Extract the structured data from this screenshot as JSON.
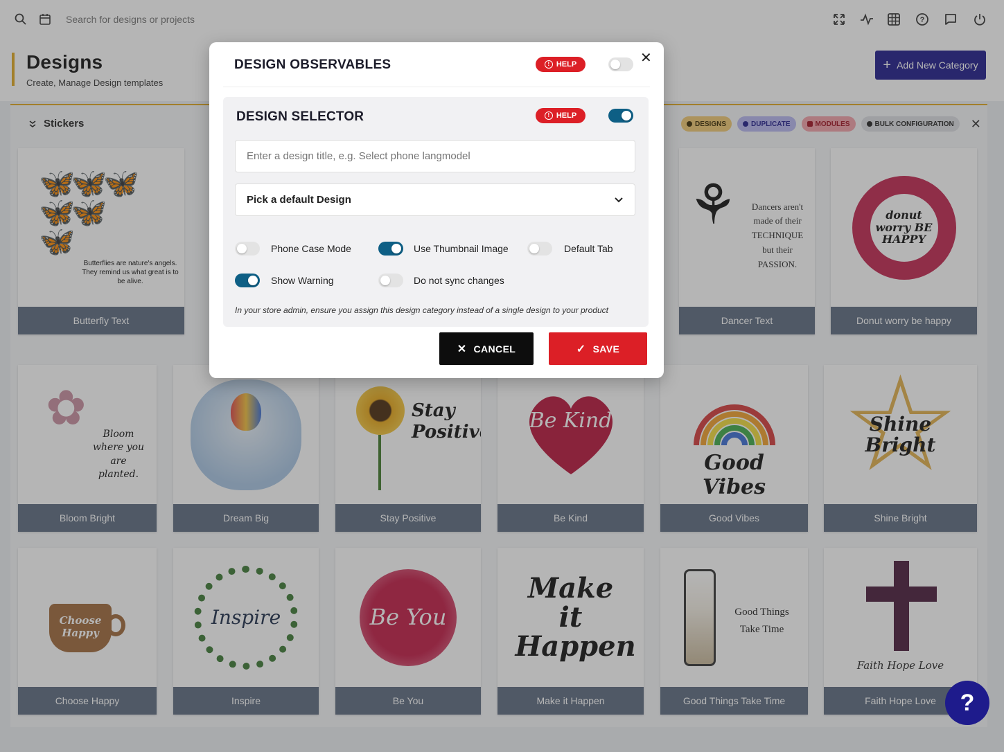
{
  "topbar": {
    "search_placeholder": "Search for designs or projects",
    "icons": [
      "search-icon",
      "calendar-icon",
      "expand-icon",
      "activity-icon",
      "grid-icon",
      "help-icon",
      "chat-icon",
      "power-icon"
    ]
  },
  "header": {
    "title": "Designs",
    "subtitle": "Create, Manage Design templates",
    "add_button": "Add New Category"
  },
  "section": {
    "title": "Stickers",
    "chips": [
      "DESIGNS",
      "DUPLICATE",
      "MODULES",
      "BULK CONFIGURATION"
    ]
  },
  "cards": [
    {
      "label": "Butterfly Text",
      "art": "Butterflies are nature's angels. They remind us what great is to be alive."
    },
    {
      "label": "Dancer Text",
      "art": "Dancers aren't made of their TECHNIQUE but their PASSION."
    },
    {
      "label": "Donut worry be happy",
      "art": "donut worry BE HAPPY"
    },
    {
      "label": "Bloom Bright",
      "art": "Bloom where you are planted."
    },
    {
      "label": "Dream Big",
      "art": ""
    },
    {
      "label": "Stay Positive",
      "art": "Stay Positive"
    },
    {
      "label": "Be Kind",
      "art": "Be Kind"
    },
    {
      "label": "Good Vibes",
      "art": "Good Vibes"
    },
    {
      "label": "Shine Bright",
      "art": "Shine Bright"
    },
    {
      "label": "Choose Happy",
      "art": "Choose Happy"
    },
    {
      "label": "Inspire",
      "art": "Inspire"
    },
    {
      "label": "Be You",
      "art": "Be You"
    },
    {
      "label": "Make it Happen",
      "art": "Make it Happen"
    },
    {
      "label": "Good Things Take Time",
      "art": "Good Things Take Time"
    },
    {
      "label": "Faith Hope Love",
      "art": "Faith Hope Love"
    }
  ],
  "modal": {
    "title": "DESIGN OBSERVABLES",
    "help": "HELP",
    "observables_enabled": false,
    "selector": {
      "title": "DESIGN SELECTOR",
      "help": "HELP",
      "enabled": true,
      "title_input_placeholder": "Enter a design title, e.g. Select phone langmodel",
      "default_design": "Pick a default Design",
      "options": [
        {
          "label": "Phone Case Mode",
          "on": false
        },
        {
          "label": "Use Thumbnail Image",
          "on": true
        },
        {
          "label": "Default Tab",
          "on": false
        },
        {
          "label": "Show Warning",
          "on": true
        },
        {
          "label": "Do not sync changes",
          "on": false
        }
      ],
      "note": "In your store admin, ensure you assign this design category instead of a single design to your product"
    },
    "cancel": "CANCEL",
    "save": "SAVE"
  },
  "fab_label": "?"
}
